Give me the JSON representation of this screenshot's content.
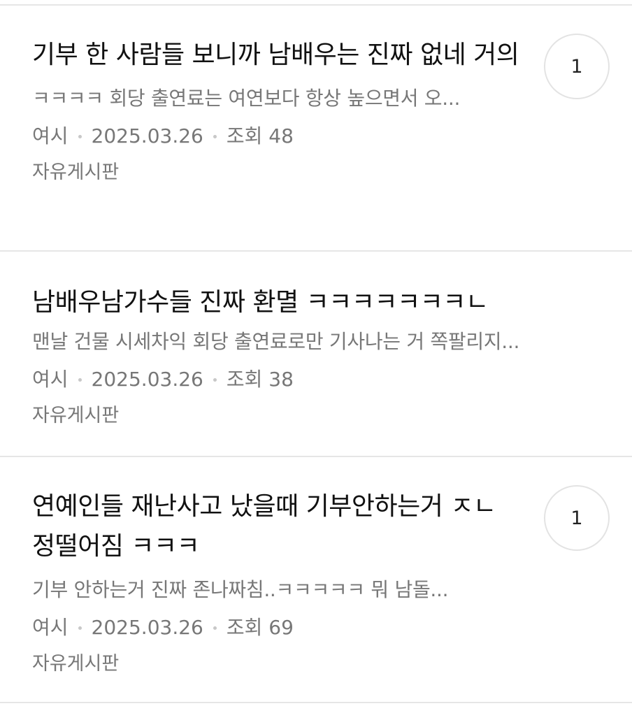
{
  "posts": [
    {
      "title": "기부 한 사람들 보니까 남배우는 진짜 없네 거의",
      "snippet": "ㅋㅋㅋㅋ 회당 출연료는 여연보다 항상 높으면서 오...",
      "author": "여시",
      "date": "2025.03.26",
      "views": "조회 48",
      "board": "자유게시판",
      "comments": "1"
    },
    {
      "title": "남배우남가수들 진짜 환멸 ㅋㅋㅋㅋㅋㅋㅋㄴ",
      "snippet": "맨날 건물 시세차익 회당 출연료로만 기사나는 거 쪽팔리지...",
      "author": "여시",
      "date": "2025.03.26",
      "views": "조회 38",
      "board": "자유게시판",
      "comments": ""
    },
    {
      "title": "연예인들 재난사고 났을때 기부안하는거 ㅈㄴ 정떨어짐 ㅋㅋㅋ",
      "snippet": "기부 안하는거 진짜 존나짜침..ㅋㅋㅋㅋㅋ 뭐 남돌...",
      "author": "여시",
      "date": "2025.03.26",
      "views": "조회 69",
      "board": "자유게시판",
      "comments": "1"
    }
  ]
}
